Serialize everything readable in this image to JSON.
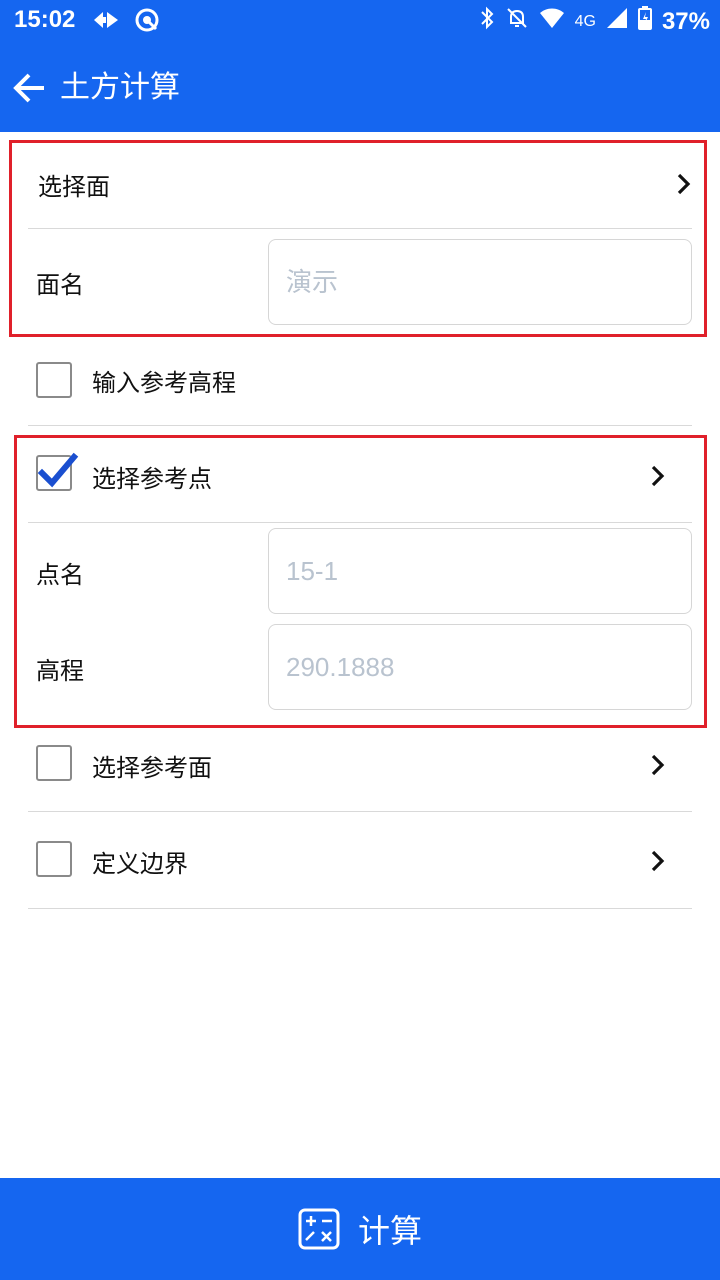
{
  "status_bar": {
    "time": "15:02",
    "network": "4G",
    "battery": "37%",
    "icons": [
      "forward-icon",
      "target-icon",
      "bluetooth-icon",
      "bell-off-icon",
      "wifi-icon",
      "signal-icon",
      "battery-charging-icon"
    ]
  },
  "app_bar": {
    "title": "土方计算",
    "back_icon": "arrow-left-icon"
  },
  "form": {
    "select_surface": {
      "label": "选择面"
    },
    "surface_name": {
      "label": "面名",
      "placeholder": "演示"
    },
    "input_ref_elevation": {
      "label": "输入参考高程",
      "checked": false
    },
    "select_ref_point": {
      "label": "选择参考点",
      "checked": true
    },
    "point_name": {
      "label": "点名",
      "placeholder": "15-1"
    },
    "elevation": {
      "label": "高程",
      "placeholder": "290.1888"
    },
    "select_ref_surface": {
      "label": "选择参考面",
      "checked": false
    },
    "define_boundary": {
      "label": "定义边界",
      "checked": false
    }
  },
  "bottom": {
    "calc_label": "计算",
    "calc_icon": "calculator-icon"
  },
  "colors": {
    "primary": "#1566f0",
    "highlight": "#e0202a",
    "check": "#1a4fd0"
  }
}
